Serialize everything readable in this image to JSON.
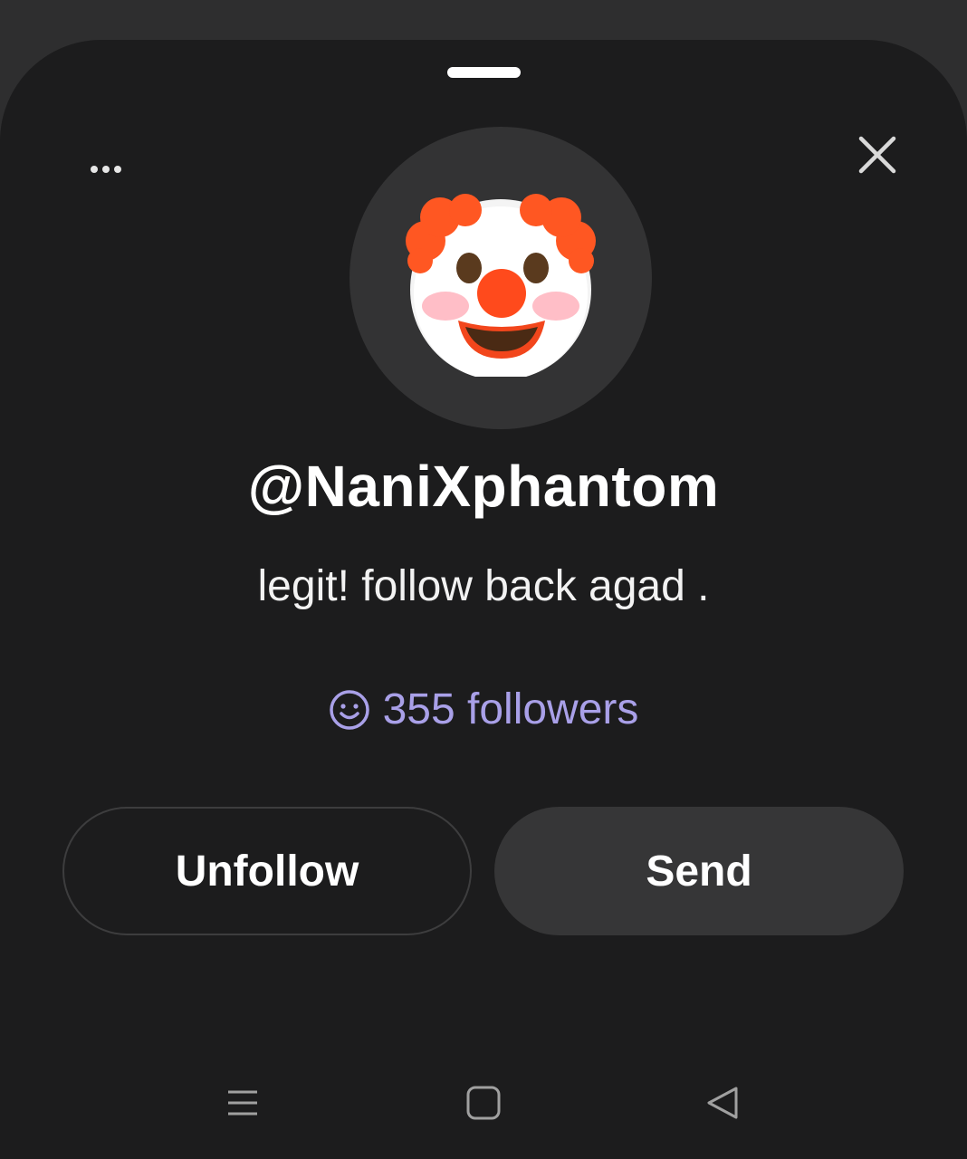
{
  "profile": {
    "username": "@NaniXphantom",
    "bio": "legit! follow back agad .",
    "followers_label": "355 followers",
    "avatar_emoji": "clown-face"
  },
  "actions": {
    "unfollow_label": "Unfollow",
    "send_label": "Send"
  },
  "icons": {
    "more": "more-horizontal-icon",
    "close": "close-icon",
    "followers": "smiley-icon",
    "nav_menu": "recent-apps-icon",
    "nav_home": "home-icon",
    "nav_back": "back-icon"
  },
  "colors": {
    "sheet_background": "#1c1c1d",
    "followers_accent": "#a9a0e8",
    "send_button": "#363637"
  }
}
